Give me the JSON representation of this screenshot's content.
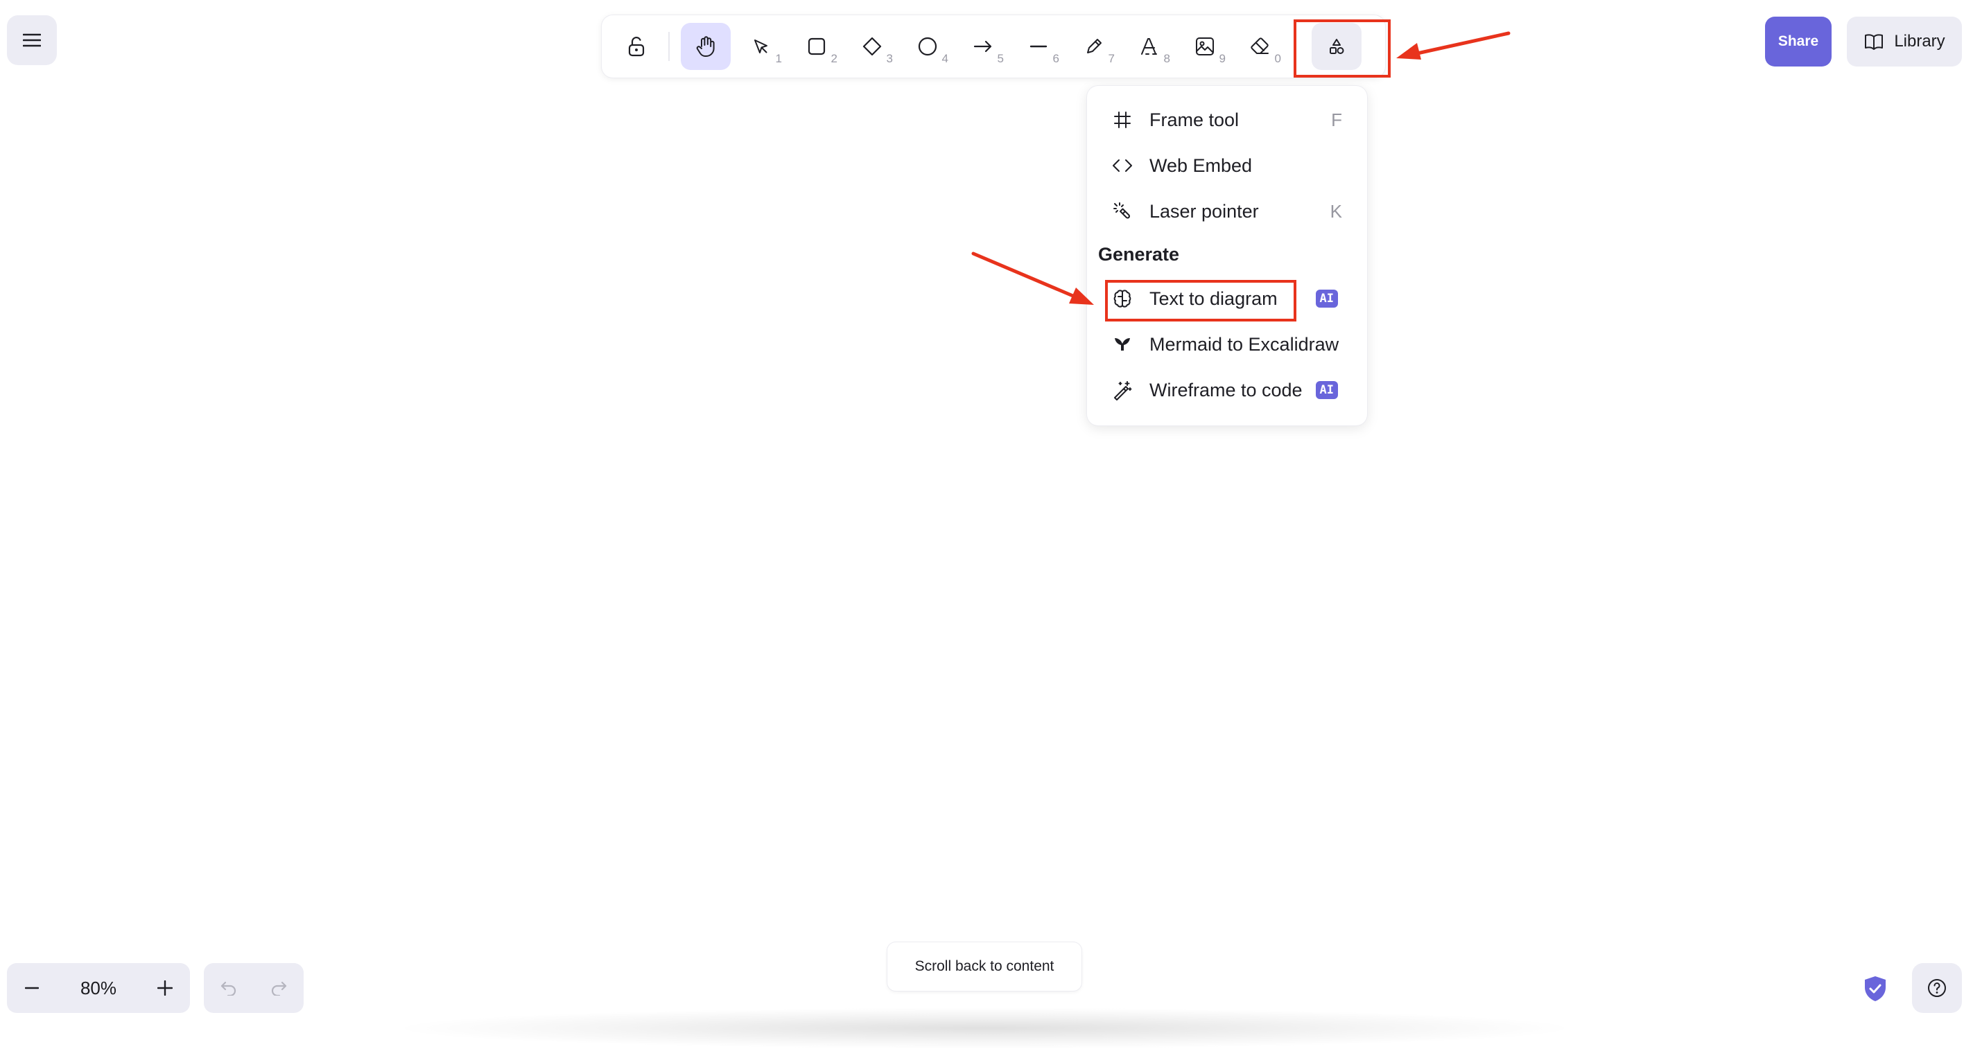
{
  "toolbar": {
    "tools": [
      {
        "name": "lock",
        "icon": "lock-open-icon",
        "key": ""
      },
      {
        "name": "hand",
        "icon": "hand-icon",
        "key": "",
        "active": true
      },
      {
        "name": "selection",
        "icon": "pointer-icon",
        "key": "1"
      },
      {
        "name": "rectangle",
        "icon": "square-icon",
        "key": "2"
      },
      {
        "name": "diamond",
        "icon": "diamond-icon",
        "key": "3"
      },
      {
        "name": "ellipse",
        "icon": "circle-icon",
        "key": "4"
      },
      {
        "name": "arrow",
        "icon": "arrow-right-icon",
        "key": "5"
      },
      {
        "name": "line",
        "icon": "line-icon",
        "key": "6"
      },
      {
        "name": "draw",
        "icon": "pencil-icon",
        "key": "7"
      },
      {
        "name": "text",
        "icon": "text-icon",
        "key": "8"
      },
      {
        "name": "image",
        "icon": "image-icon",
        "key": "9"
      },
      {
        "name": "eraser",
        "icon": "eraser-icon",
        "key": "0"
      },
      {
        "name": "more-tools",
        "icon": "shapes-icon",
        "key": ""
      }
    ]
  },
  "header": {
    "share_label": "Share",
    "library_label": "Library"
  },
  "dropdown": {
    "items": [
      {
        "label": "Frame tool",
        "shortcut": "F",
        "icon": "frame-icon"
      },
      {
        "label": "Web Embed",
        "shortcut": "",
        "icon": "code-icon"
      },
      {
        "label": "Laser pointer",
        "shortcut": "K",
        "icon": "laser-pointer-icon"
      }
    ],
    "generate_heading": "Generate",
    "generate_items": [
      {
        "label": "Text to diagram",
        "badge": "AI",
        "icon": "brain-icon"
      },
      {
        "label": "Mermaid to Excalidraw",
        "badge": "",
        "icon": "mermaid-icon"
      },
      {
        "label": "Wireframe to code",
        "badge": "AI",
        "icon": "magic-wand-icon"
      }
    ]
  },
  "footer": {
    "zoom_level": "80%",
    "scroll_back_label": "Scroll back to content"
  },
  "colors": {
    "accent": "#6965db",
    "active_tool_bg": "#e0dfff",
    "panel_bg": "#ececf4",
    "annotation_red": "#e8331c"
  }
}
